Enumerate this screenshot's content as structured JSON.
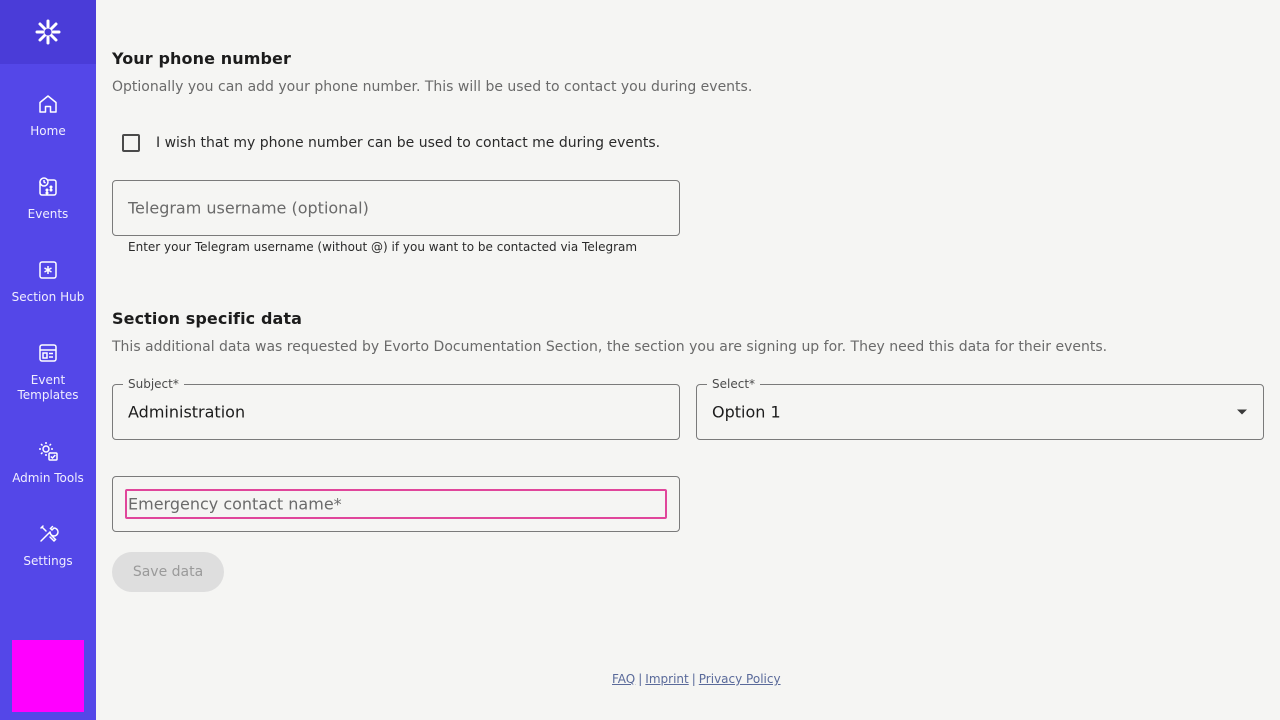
{
  "sidebar": {
    "logo_icon": "asterisk-logo-icon",
    "items": [
      {
        "label": "Home",
        "icon": "home-icon"
      },
      {
        "label": "Events",
        "icon": "events-icon"
      },
      {
        "label": "Section Hub",
        "icon": "section-hub-icon"
      },
      {
        "label": "Event Templates",
        "icon": "templates-icon"
      },
      {
        "label": "Admin Tools",
        "icon": "admin-tools-icon"
      },
      {
        "label": "Settings",
        "icon": "settings-icon"
      }
    ],
    "avatar_color": "#ff00ff",
    "background": "#5447e8"
  },
  "phone": {
    "title": "Your phone number",
    "description": "Optionally you can add your phone number. This will be used to contact you during events.",
    "checkbox_label": "I wish that my phone number can be used to contact me during events.",
    "checkbox_checked": false,
    "telegram_placeholder": "Telegram username (optional)",
    "telegram_helper": "Enter your Telegram username (without @) if you want to be contacted via Telegram"
  },
  "section": {
    "title": "Section specific data",
    "description": "This additional data was requested by Evorto Documentation Section, the section you are signing up for. They need this data for their events.",
    "subject_label": "Subject*",
    "subject_value": "Administration",
    "select_label": "Select*",
    "select_value": "Option 1",
    "emergency_placeholder": "Emergency contact name*",
    "focus_color": "#e0469b"
  },
  "actions": {
    "save_label": "Save data"
  },
  "footer": {
    "faq": "FAQ",
    "imprint": "Imprint",
    "privacy": "Privacy Policy",
    "separator": "|"
  }
}
